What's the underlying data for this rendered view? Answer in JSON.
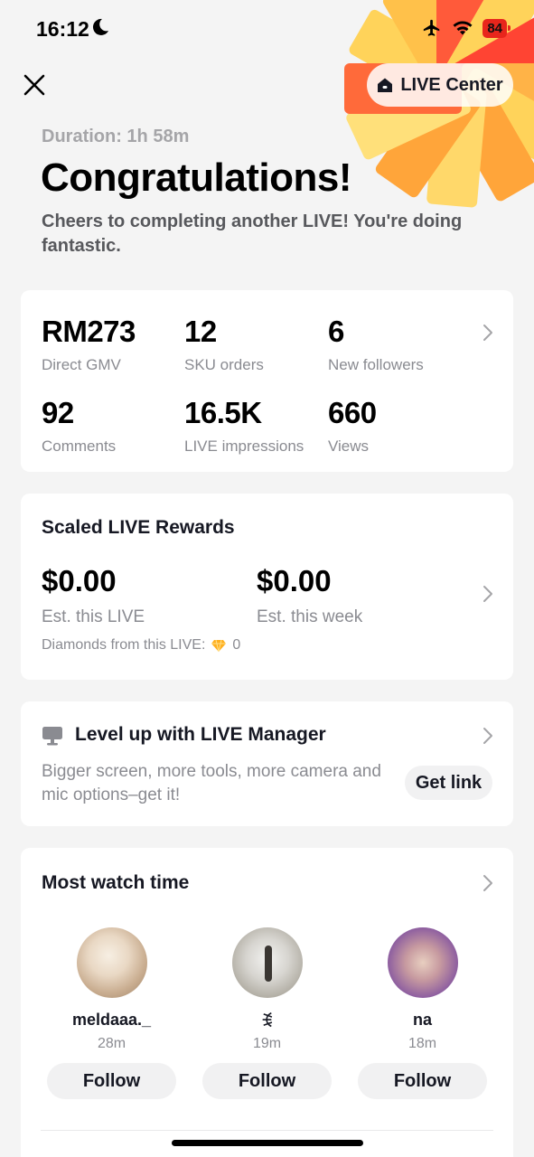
{
  "status_bar": {
    "time": "16:12",
    "battery": "84"
  },
  "header": {
    "live_center_label": "LIVE Center"
  },
  "summary": {
    "duration": "Duration: 1h 58m",
    "title": "Congratulations!",
    "subtitle": "Cheers to completing another LIVE! You're doing fantastic."
  },
  "stats": [
    {
      "value": "RM273",
      "label": "Direct GMV"
    },
    {
      "value": "12",
      "label": "SKU orders"
    },
    {
      "value": "6",
      "label": "New followers"
    },
    {
      "value": "92",
      "label": "Comments"
    },
    {
      "value": "16.5K",
      "label": "LIVE impressions"
    },
    {
      "value": "660",
      "label": "Views"
    }
  ],
  "rewards": {
    "title": "Scaled LIVE Rewards",
    "items": [
      {
        "value": "$0.00",
        "label": "Est. this LIVE"
      },
      {
        "value": "$0.00",
        "label": "Est. this week"
      }
    ],
    "diamonds_label": "Diamonds from this LIVE:",
    "diamonds_value": "0"
  },
  "live_manager": {
    "title": "Level up with LIVE Manager",
    "description": "Bigger screen, more tools, more camera and mic options–get it!",
    "button": "Get link"
  },
  "most_watch_time": {
    "title": "Most watch time",
    "viewers": [
      {
        "name": "meldaaa._",
        "time": "28m",
        "follow": "Follow"
      },
      {
        "name": "ꉂ",
        "time": "19m",
        "follow": "Follow"
      },
      {
        "name": "na",
        "time": "18m",
        "follow": "Follow"
      }
    ]
  },
  "colors": {
    "accent_red": "#e8261c",
    "burst_orange": "#ffa53a",
    "burst_yellow": "#ffd35a"
  }
}
